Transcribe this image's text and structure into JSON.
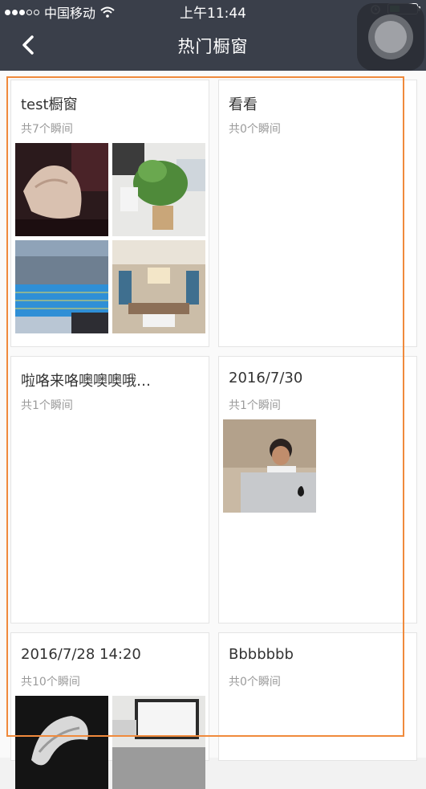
{
  "status_bar": {
    "carrier": "中国移动",
    "time": "上午11:44"
  },
  "nav": {
    "title": "热门橱窗",
    "back_icon": "chevron-left-icon"
  },
  "colors": {
    "bar_bg": "#3a3f4a",
    "highlight_border": "#f08a3c",
    "battery_green": "#4cd964"
  },
  "windows": [
    {
      "name": "test橱窗",
      "count": "共7个瞬间",
      "photos": [
        "seashell-sculpture",
        "potted-plant-office",
        "swimming-pool",
        "living-room"
      ]
    },
    {
      "name": "看看",
      "count": "共0个瞬间",
      "photos": []
    },
    {
      "name": "啦咯来咯噢噢噢哦…",
      "count": "共1个瞬间",
      "photos": []
    },
    {
      "name": "2016/7/30",
      "count": "共1个瞬间",
      "photos": [
        "person-at-laptop"
      ]
    },
    {
      "name": "2016/7/28 14:20",
      "count": "共10个瞬间",
      "photos": [
        "white-sculpture",
        "office-monitor"
      ]
    },
    {
      "name": "Bbbbbbb",
      "count": "共0个瞬间",
      "photos": []
    }
  ]
}
